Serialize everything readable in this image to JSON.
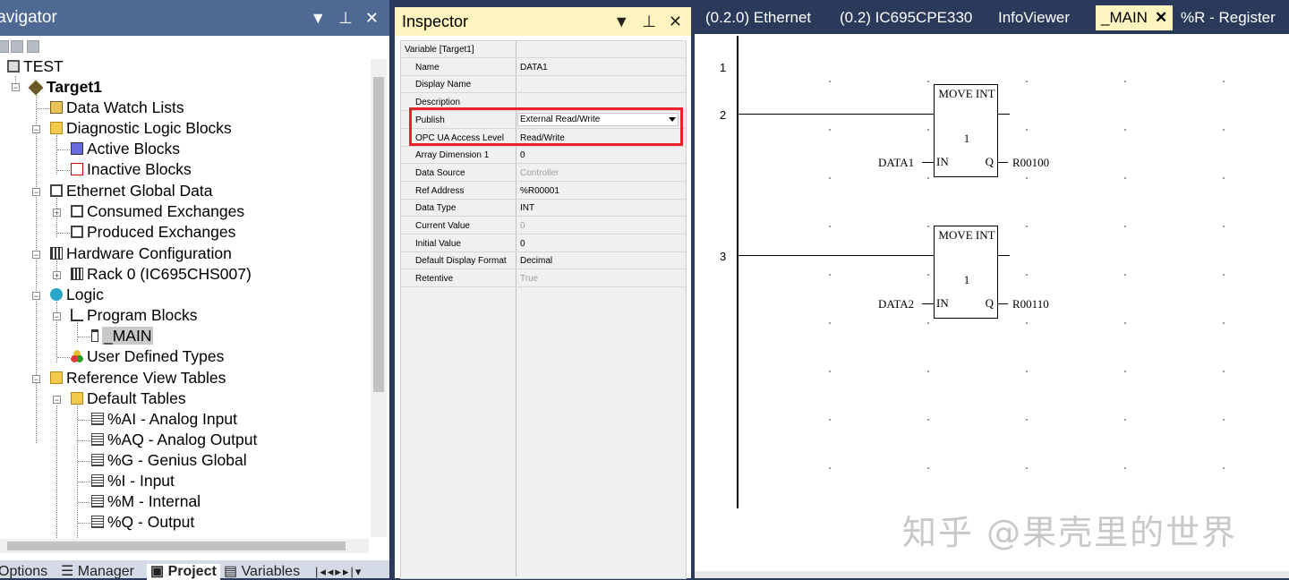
{
  "navigator": {
    "title": "Navigator",
    "title_visible": "lavigator",
    "tree": [
      {
        "label": "TEST",
        "icon": "project-icon"
      },
      {
        "label": "Target1",
        "icon": "target-icon",
        "bold": true
      },
      {
        "label": "Data Watch Lists",
        "icon": "watch-list-icon"
      },
      {
        "label": "Diagnostic Logic Blocks",
        "icon": "folder-icon"
      },
      {
        "label": "Active Blocks",
        "icon": "block-icon"
      },
      {
        "label": "Inactive Blocks",
        "icon": "block-icon"
      },
      {
        "label": "Ethernet Global Data",
        "icon": "egd-icon"
      },
      {
        "label": "Consumed Exchanges",
        "icon": "exchange-icon"
      },
      {
        "label": "Produced Exchanges",
        "icon": "exchange-icon"
      },
      {
        "label": "Hardware Configuration",
        "icon": "hardware-icon"
      },
      {
        "label": "Rack 0 (IC695CHS007)",
        "icon": "rack-icon"
      },
      {
        "label": "Logic",
        "icon": "logic-icon"
      },
      {
        "label": "Program Blocks",
        "icon": "program-blocks-icon"
      },
      {
        "label": "_MAIN",
        "icon": "main-block-icon",
        "selected": true
      },
      {
        "label": "User Defined Types",
        "icon": "udt-icon"
      },
      {
        "label": "Reference View Tables",
        "icon": "folder-icon"
      },
      {
        "label": "Default Tables",
        "icon": "folder-icon"
      },
      {
        "label": "%AI - Analog Input",
        "icon": "table-icon"
      },
      {
        "label": "%AQ - Analog Output",
        "icon": "table-icon"
      },
      {
        "label": "%G - Genius Global",
        "icon": "table-icon"
      },
      {
        "label": "%I - Input",
        "icon": "table-icon"
      },
      {
        "label": "%M - Internal",
        "icon": "table-icon"
      },
      {
        "label": "%Q - Output",
        "icon": "table-icon"
      }
    ],
    "bottom_tabs": [
      "Options",
      "Manager",
      "Project",
      "Variables"
    ],
    "active_bottom_tab": "Project"
  },
  "inspector": {
    "title": "Inspector",
    "category": "Variable [Target1]",
    "properties": [
      {
        "key": "Name",
        "value": "DATA1"
      },
      {
        "key": "Display Name",
        "value": ""
      },
      {
        "key": "Description",
        "value": ""
      },
      {
        "key": "Publish",
        "value": "External Read/Write",
        "dropdown": true
      },
      {
        "key": "OPC UA Access Level",
        "value": "Read/Write"
      },
      {
        "key": "Array Dimension 1",
        "value": "0"
      },
      {
        "key": "Data Source",
        "value": "Controller",
        "grey": true
      },
      {
        "key": "Ref Address",
        "value": "%R00001"
      },
      {
        "key": "Data Type",
        "value": "INT"
      },
      {
        "key": "Current Value",
        "value": "0",
        "grey": true
      },
      {
        "key": "Initial Value",
        "value": "0"
      },
      {
        "key": "Default Display Format",
        "value": "Decimal"
      },
      {
        "key": "Retentive",
        "value": "True",
        "grey": true
      }
    ],
    "highlight_color": "#e8222a"
  },
  "editor": {
    "tabs": [
      "(0.2.0) Ethernet",
      "(0.2) IC695CPE330",
      "InfoViewer",
      "_MAIN",
      "%R - Register"
    ],
    "active_tab": "_MAIN",
    "rung_numbers": [
      "1",
      "2",
      "3"
    ],
    "blocks": [
      {
        "function": "MOVE INT",
        "length": "1",
        "in_pin": "IN",
        "q_pin": "Q",
        "input_operand": "DATA1",
        "output_operand": "R00100"
      },
      {
        "function": "MOVE INT",
        "length": "1",
        "in_pin": "IN",
        "q_pin": "Q",
        "input_operand": "DATA2",
        "output_operand": "R00110"
      }
    ],
    "watermark": "知乎 @果壳里的世界"
  },
  "colors": {
    "frame": "#2b3a5b",
    "active_tab_bg": "#fdf4bf",
    "navigator_title_bg": "#4e6994"
  }
}
